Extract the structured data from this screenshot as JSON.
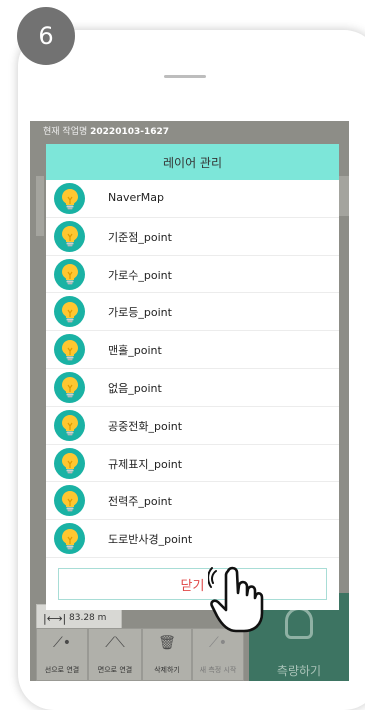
{
  "step_number": "6",
  "app_header": {
    "label": "현재 작업명",
    "job_name": "20220103-1627"
  },
  "dialog": {
    "title": "레이어 관리",
    "layers": [
      {
        "name": "NaverMap"
      },
      {
        "name": "기준점_point"
      },
      {
        "name": "가로수_point"
      },
      {
        "name": "가로등_point"
      },
      {
        "name": "맨홀_point"
      },
      {
        "name": "없음_point"
      },
      {
        "name": "공중전화_point"
      },
      {
        "name": "규제표지_point"
      },
      {
        "name": "전력주_point"
      },
      {
        "name": "도로반사경_point"
      }
    ],
    "close_label": "닫기"
  },
  "scale": {
    "value": "83.28 m"
  },
  "toolbar": {
    "line_connect": "선으로 연결",
    "polygon_connect": "면으로 연결",
    "delete": "삭제하기",
    "new_measure": "새 측정 시작",
    "measure": "측량하기"
  },
  "colors": {
    "dialog_header": "#7de6d9",
    "bulb_bg": "#1ab2a4",
    "close_text": "#e04848",
    "measure_button": "#3d7462",
    "step_badge": "#727272"
  },
  "icons": {
    "layer": "lightbulb-icon",
    "pointer": "hand-pointer-icon",
    "scale": "ruler-arrows-icon"
  }
}
